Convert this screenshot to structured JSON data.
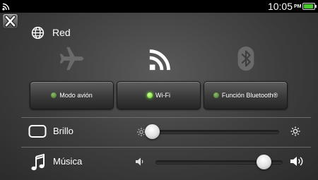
{
  "status_bar": {
    "time": "10:05",
    "ampm": "PM",
    "battery_level": 0.95,
    "battery_color": "#47c92c"
  },
  "close_icon": "close-x-icon",
  "network": {
    "title": "Red",
    "icon": "globe-icon"
  },
  "toggles": [
    {
      "label": "Modo avión",
      "icon": "airplane-icon",
      "active": false
    },
    {
      "label": "Wi-Fi",
      "icon": "wifi-icon",
      "active": true
    },
    {
      "label": "Función Bluetooth®",
      "icon": "bluetooth-icon",
      "active": false
    }
  ],
  "brightness": {
    "label": "Brillo",
    "icon": "screen-icon",
    "value": 0.03
  },
  "music": {
    "label": "Música",
    "icon": "music-note-icon",
    "value": 0.85
  }
}
